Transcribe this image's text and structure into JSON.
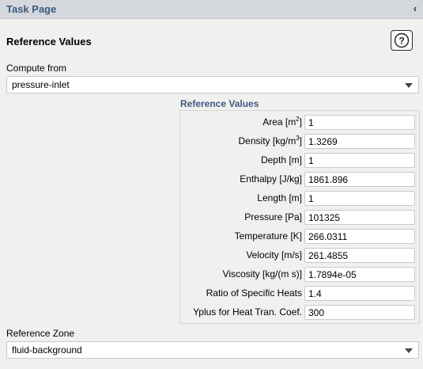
{
  "panel": {
    "title": "Task Page",
    "collapse_glyph": "‹"
  },
  "section": {
    "title": "Reference Values",
    "help_icon": "question-mark-circle-icon"
  },
  "compute_from": {
    "label": "Compute from",
    "value": "pressure-inlet"
  },
  "reference_values": {
    "title": "Reference Values",
    "rows": [
      {
        "label": "Area [m",
        "sup": "2",
        "suffix": "]",
        "value": "1"
      },
      {
        "label": "Density [kg/m",
        "sup": "3",
        "suffix": "]",
        "value": "1.3269"
      },
      {
        "label": "Depth [m]",
        "sup": "",
        "suffix": "",
        "value": "1"
      },
      {
        "label": "Enthalpy [J/kg]",
        "sup": "",
        "suffix": "",
        "value": "1861.896"
      },
      {
        "label": "Length [m]",
        "sup": "",
        "suffix": "",
        "value": "1"
      },
      {
        "label": "Pressure [Pa]",
        "sup": "",
        "suffix": "",
        "value": "101325"
      },
      {
        "label": "Temperature [K]",
        "sup": "",
        "suffix": "",
        "value": "266.0311"
      },
      {
        "label": "Velocity [m/s]",
        "sup": "",
        "suffix": "",
        "value": "261.4855"
      },
      {
        "label": "Viscosity [kg/(m s)]",
        "sup": "",
        "suffix": "",
        "value": "1.7894e-05"
      },
      {
        "label": "Ratio of Specific Heats",
        "sup": "",
        "suffix": "",
        "value": "1.4"
      },
      {
        "label": "Yplus for Heat Tran. Coef.",
        "sup": "",
        "suffix": "",
        "value": "300"
      }
    ]
  },
  "reference_zone": {
    "label": "Reference Zone",
    "value": "fluid-background"
  },
  "colors": {
    "header_bg": "#d4d7dc",
    "group_title": "#3c5a7e",
    "background": "#f0f0f0"
  }
}
